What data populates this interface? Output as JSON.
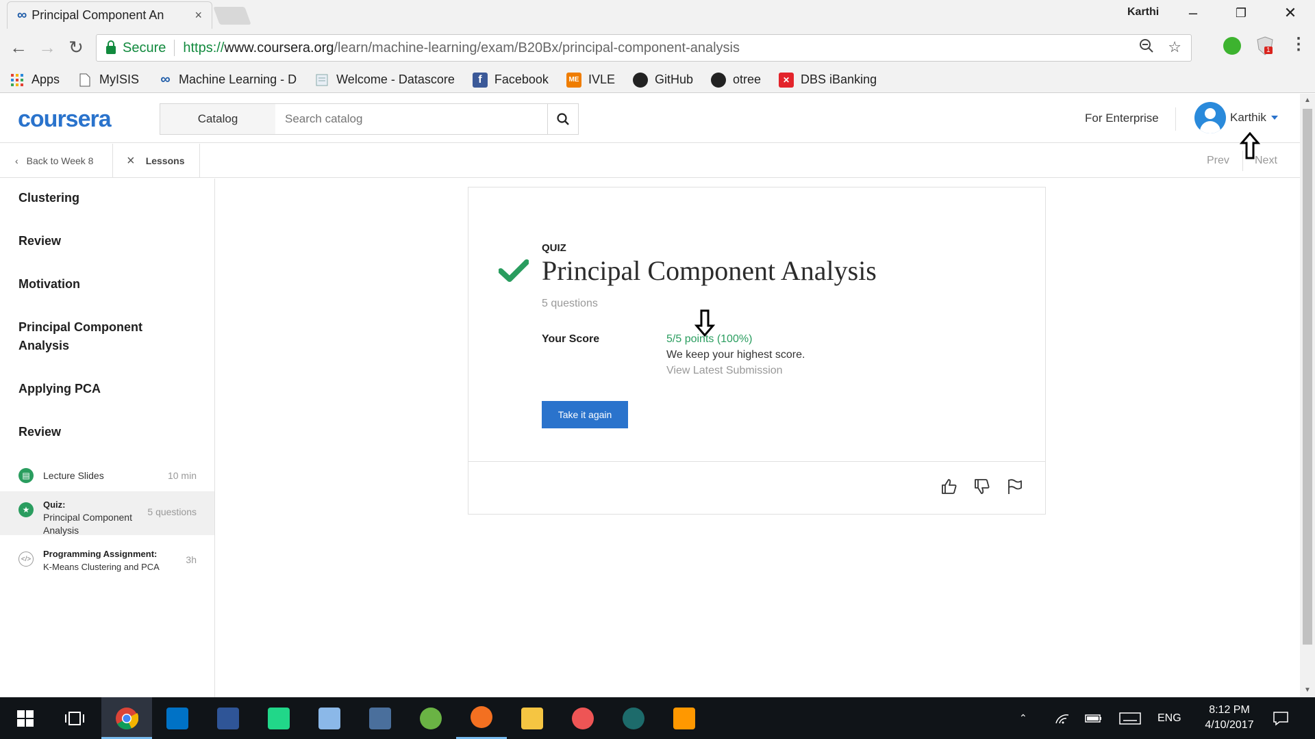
{
  "browser": {
    "tab_title": "Principal Component An",
    "tab_close": "×",
    "window_user": "Karthi",
    "secure_label": "Secure",
    "url_scheme": "https://",
    "url_host": "www.coursera.org",
    "url_path": "/learn/machine-learning/exam/B20Bx/principal-component-analysis",
    "extension_badge": "1",
    "bookmarks": [
      {
        "label": "Apps",
        "icon": "apps-grid-icon"
      },
      {
        "label": "MyISIS",
        "icon": "page-icon"
      },
      {
        "label": "Machine Learning - D",
        "icon": "coursera-icon"
      },
      {
        "label": "Welcome - Datascore",
        "icon": "page-icon"
      },
      {
        "label": "Facebook",
        "icon": "facebook-icon",
        "glyph": "f"
      },
      {
        "label": "IVLE",
        "icon": "ivle-icon",
        "glyph": "ME"
      },
      {
        "label": "GitHub",
        "icon": "github-icon"
      },
      {
        "label": "otree",
        "icon": "github-icon"
      },
      {
        "label": "DBS iBanking",
        "icon": "dbs-icon"
      }
    ]
  },
  "header": {
    "logo": "coursera",
    "catalog": "Catalog",
    "search_placeholder": "Search catalog",
    "enterprise": "For Enterprise",
    "username": "Karthik"
  },
  "subnav": {
    "back": "Back to Week 8",
    "lessons": "Lessons",
    "prev": "Prev",
    "next": "Next"
  },
  "sidebar": {
    "sections": [
      "Clustering",
      "Review",
      "Motivation",
      "Principal Component Analysis",
      "Applying PCA",
      "Review"
    ],
    "items": [
      {
        "title": "Lecture Slides",
        "meta": "10 min",
        "icon": "slides-icon"
      },
      {
        "type": "Quiz:",
        "title": "Principal Component Analysis",
        "meta": "5 questions",
        "icon": "quiz-star-icon"
      },
      {
        "type": "Programming Assignment:",
        "title": "K-Means Clustering and PCA",
        "meta": "3h",
        "icon": "code-icon"
      }
    ]
  },
  "quiz": {
    "label": "QUIZ",
    "title": "Principal Component Analysis",
    "count": "5 questions",
    "score_label": "Your Score",
    "score_value": "5/5 points (100%)",
    "score_note": "We keep your highest score.",
    "view_latest": "View Latest Submission",
    "take_again": "Take it again"
  },
  "taskbar": {
    "lang": "ENG",
    "time": "8:12 PM",
    "date": "4/10/2017"
  },
  "colors": {
    "coursera_blue": "#2a73cc",
    "success_green": "#2a9d5f",
    "secure_green": "#128a3e"
  }
}
